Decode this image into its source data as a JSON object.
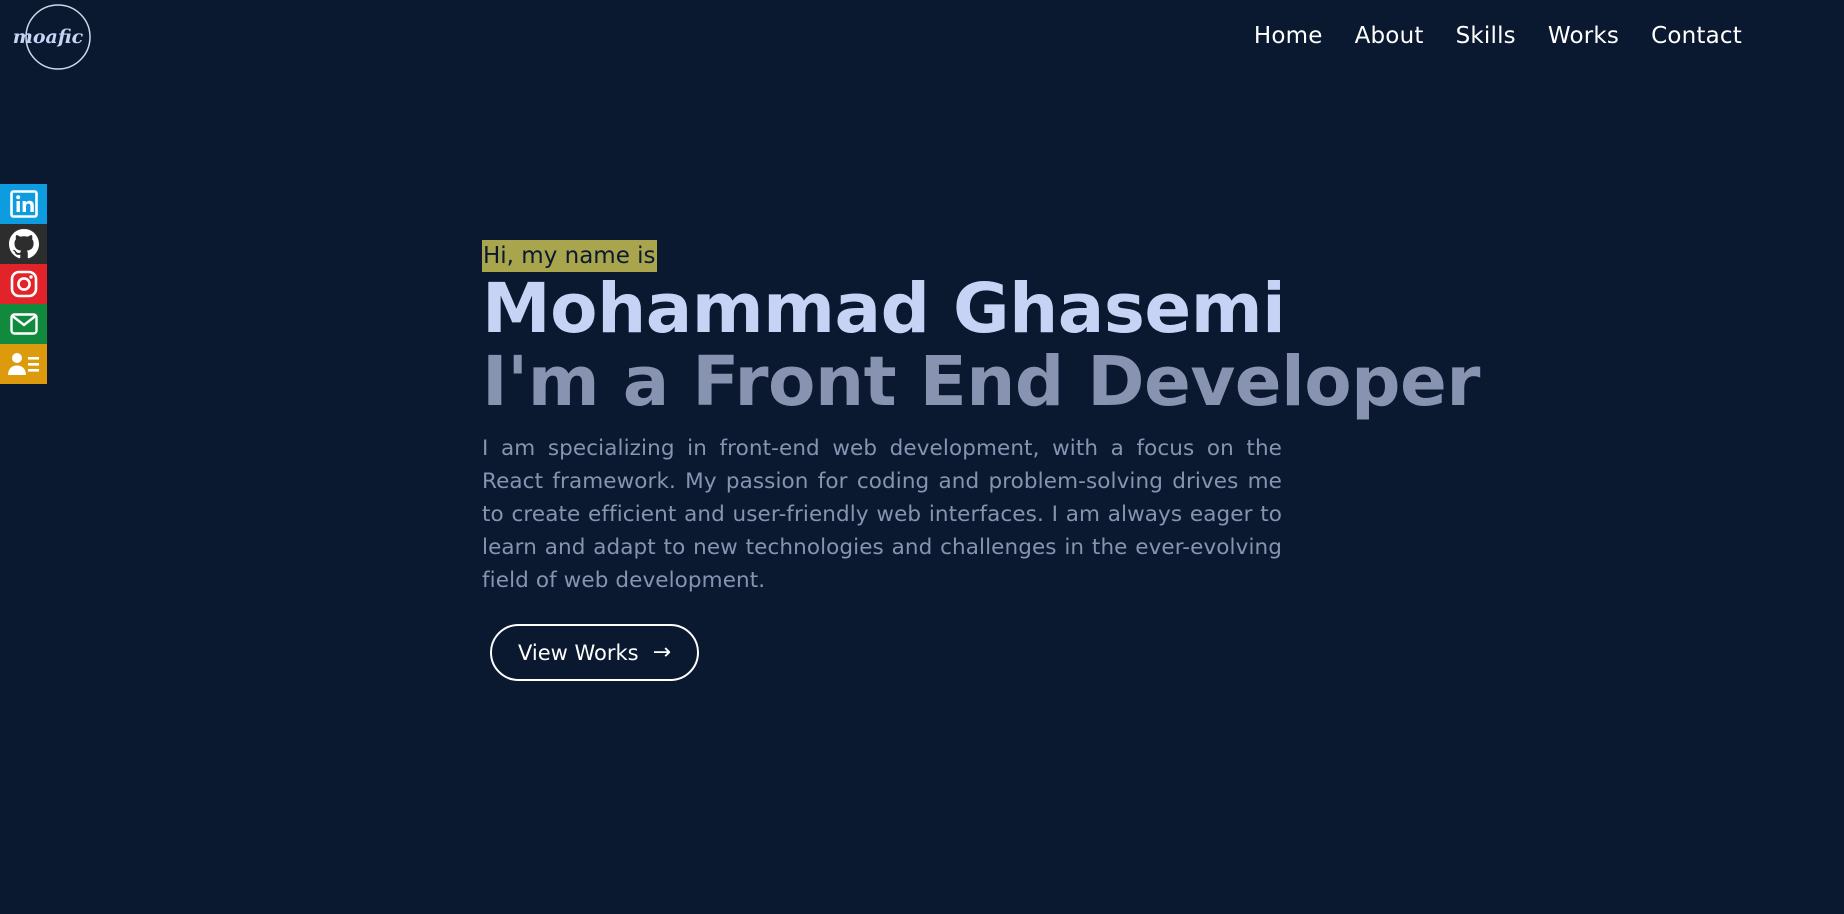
{
  "logo": {
    "text": "moafic"
  },
  "nav": {
    "items": [
      {
        "label": "Home"
      },
      {
        "label": "About"
      },
      {
        "label": "Skills"
      },
      {
        "label": "Works"
      },
      {
        "label": "Contact"
      }
    ]
  },
  "social": {
    "items": [
      {
        "icon": "linkedin-icon",
        "color": "#0e9ce0"
      },
      {
        "icon": "github-icon",
        "color": "#2d2d2d"
      },
      {
        "icon": "instagram-icon",
        "color": "#e2232a"
      },
      {
        "icon": "mail-icon",
        "color": "#128a3e"
      },
      {
        "icon": "resume-icon",
        "color": "#dd9a0c"
      }
    ]
  },
  "hero": {
    "greeting": "Hi, my name is",
    "name": "Mohammad Ghasemi",
    "role": "I'm a Front End Developer",
    "bio": "I am specializing in front-end web development, with a focus on the React framework. My passion for coding and problem-solving drives me to create efficient and user-friendly web interfaces. I am always eager to learn and adapt to new technologies and challenges in the ever-evolving field of web development.",
    "cta_label": "View Works",
    "cta_icon": "arrow-right-icon"
  },
  "colors": {
    "background": "#0a1930",
    "greeting_highlight": "#a8a54d",
    "greeting_text": "#0a1930",
    "name": "#c7d3f5",
    "role": "#8893b1",
    "bio": "#8893b1",
    "nav_text": "#ffffff"
  }
}
